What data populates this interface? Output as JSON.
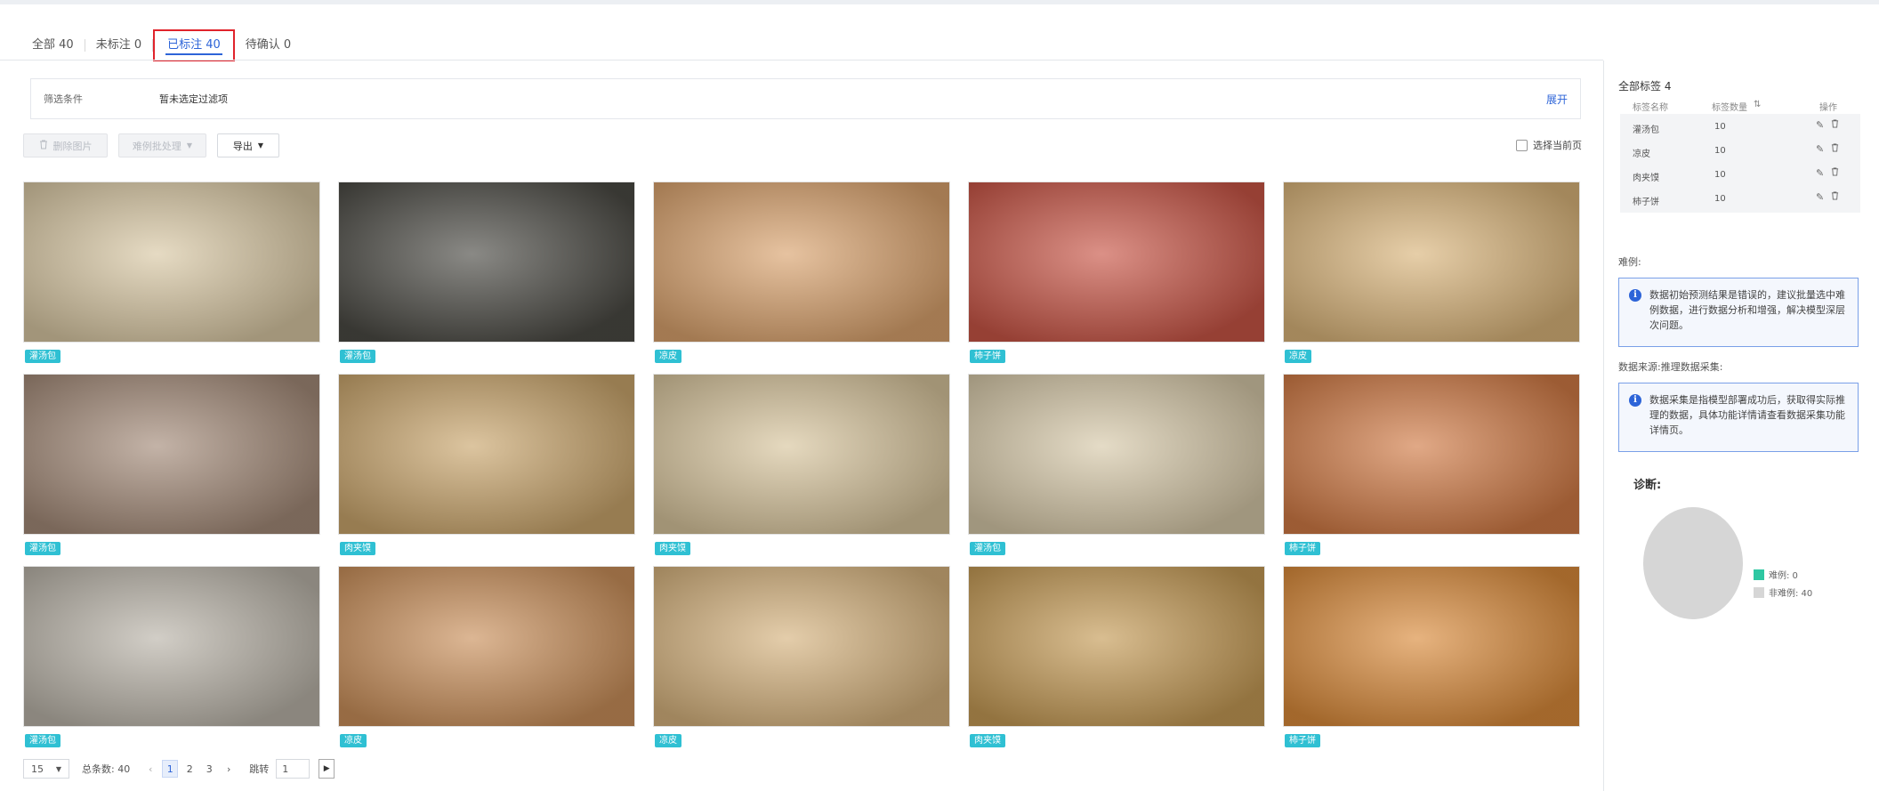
{
  "tabs": [
    {
      "label": "全部 40"
    },
    {
      "label": "未标注 0"
    },
    {
      "label": "已标注 40"
    },
    {
      "label": "待确认 0"
    }
  ],
  "filter": {
    "label": "筛选条件",
    "value": "暂未选定过滤项",
    "expand": "展开"
  },
  "toolbar": {
    "delete_label": "删除图片",
    "hard_label": "难例批处理",
    "export_label": "导出",
    "select_page_label": "选择当前页"
  },
  "cards": [
    {
      "tag": "灌汤包",
      "image": "soup-dumplings-in-steamer",
      "bg": "#d8c7a3"
    },
    {
      "tag": "灌汤包",
      "image": "soup-dumplings-on-dark-plate",
      "bg": "#4b4a44"
    },
    {
      "tag": "凉皮",
      "image": "liangpi-noodles-with-chili",
      "bg": "#d9a26d"
    },
    {
      "tag": "柿子饼",
      "image": "dried-persimmon-cakes",
      "bg": "#c85546"
    },
    {
      "tag": "凉皮",
      "image": "liangpi-with-cucumber",
      "bg": "#d9b47a"
    },
    {
      "tag": "灌汤包",
      "image": "soup-dumplings-close-up",
      "bg": "#a38a78"
    },
    {
      "tag": "肉夹馍",
      "image": "roujiamo-sandwiches",
      "bg": "#c9a56c"
    },
    {
      "tag": "肉夹馍",
      "image": "roujiamo-on-plate",
      "bg": "#d7c49c"
    },
    {
      "tag": "灌汤包",
      "image": "soup-dumplings-with-spoon",
      "bg": "#d6c8a8"
    },
    {
      "tag": "柿子饼",
      "image": "dried-persimmons-in-bowl",
      "bg": "#d07a45"
    },
    {
      "tag": "灌汤包",
      "image": "soup-dumplings-in-metal-steamer",
      "bg": "#b9b3a8"
    },
    {
      "tag": "凉皮",
      "image": "liangpi-on-black-plate",
      "bg": "#c98f5a"
    },
    {
      "tag": "凉皮",
      "image": "liangpi-noodles-with-sprouts",
      "bg": "#d5b27d"
    },
    {
      "tag": "肉夹馍",
      "image": "baked-bread-buns",
      "bg": "#c49a55"
    },
    {
      "tag": "柿子饼",
      "image": "dried-persimmon-halves",
      "bg": "#d98a3a"
    }
  ],
  "pager": {
    "size": "15",
    "total": "总条数: 40",
    "pages": [
      "1",
      "2",
      "3"
    ],
    "current": "1",
    "jump_label": "跳转",
    "jump_value": "1"
  },
  "side": {
    "title": "全部标签  4",
    "col_name": "标签名称",
    "col_count": "标签数量",
    "col_ops": "操作",
    "labels": [
      {
        "name": "灌汤包",
        "count": "10"
      },
      {
        "name": "凉皮",
        "count": "10"
      },
      {
        "name": "肉夹馍",
        "count": "10"
      },
      {
        "name": "柿子饼",
        "count": "10"
      }
    ],
    "hard_label": "难例:",
    "hard_notice": "数据初始预测结果是错误的，建议批量选中难例数据，进行数据分析和增强，解决模型深层次问题。",
    "source_label": "数据来源:推理数据采集:",
    "source_notice": "数据采集是指模型部署成功后，获取得实际推理的数据，具体功能详情请查看数据采集功能详情页。",
    "diag_label": "诊断:",
    "legend_hard": "难例: 0",
    "legend_nonhard": "非难例: 40",
    "hard_count": 0,
    "nonhard_count": 40,
    "color_hard": "#2ec7a2",
    "color_nonhard": "#d6d6d6"
  },
  "colors": {
    "accent": "#2d64d8",
    "tag": "#2fc0d3",
    "active_outline": "#e0232b"
  }
}
